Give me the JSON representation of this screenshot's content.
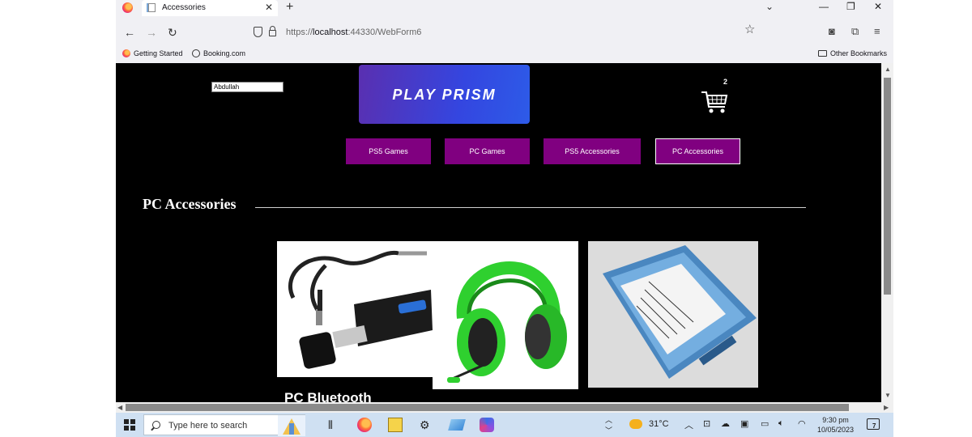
{
  "browser": {
    "tab_title": "Accessories",
    "tab_close": "✕",
    "new_tab": "+",
    "tab_list": "⌄",
    "minimize": "—",
    "restore": "❐",
    "close": "✕",
    "back": "←",
    "forward": "→",
    "reload": "↻",
    "url_prefix": "https://",
    "url_host": "localhost",
    "url_rest": ":44330/WebForm6",
    "bookmark_star": "☆",
    "pocket": "◙",
    "extensions": "⧉",
    "menu": "≡",
    "bookmarks": [
      "Getting Started",
      "Booking.com"
    ],
    "other_bookmarks": "Other Bookmarks"
  },
  "page": {
    "user_name": "Abdullah",
    "logo_text": "PLAY PRISM",
    "cart_count": "2",
    "nav": [
      {
        "label": "PS5 Games",
        "active": false
      },
      {
        "label": "PC Games",
        "active": false
      },
      {
        "label": "PS5 Accessories",
        "active": false
      },
      {
        "label": "PC Accessories",
        "active": true
      }
    ],
    "section_title": "PC Accessories",
    "products": [
      {
        "icon": "bluetooth-adapter-image"
      },
      {
        "icon": "green-headset-image"
      },
      {
        "icon": "ssd-drive-image"
      }
    ],
    "first_product_name": "PC Bluetooth"
  },
  "taskbar": {
    "search_placeholder": "Type here to search",
    "temperature": "31°C",
    "time": "9:30 pm",
    "date": "10/05/2023",
    "notification_count": "7"
  },
  "colors": {
    "nav_button": "#800080",
    "page_bg": "#000000",
    "taskbar": "#cfe0f2"
  }
}
